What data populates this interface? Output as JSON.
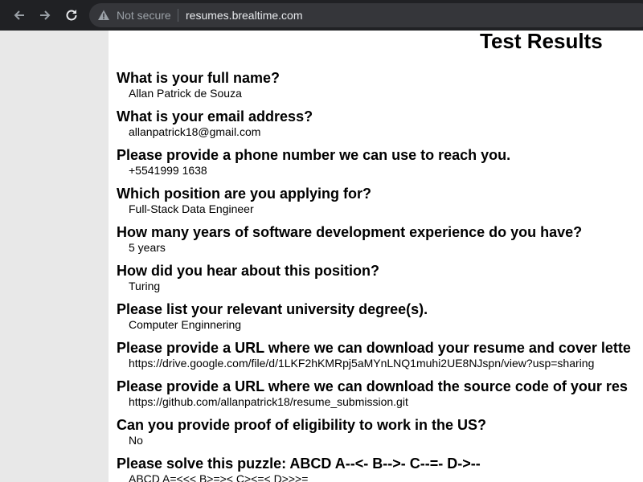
{
  "browser": {
    "security_label": "Not secure",
    "url": "resumes.brealtime.com",
    "icons": [
      "back-arrow-icon",
      "forward-arrow-icon",
      "reload-icon",
      "warning-triangle-icon"
    ]
  },
  "page": {
    "title": "Test Results",
    "items": [
      {
        "question": "What is your full name?",
        "answer": "Allan Patrick de Souza"
      },
      {
        "question": "What is your email address?",
        "answer": "allanpatrick18@gmail.com"
      },
      {
        "question": "Please provide a phone number we can use to reach you.",
        "answer": "+5541999 1638"
      },
      {
        "question": "Which position are you applying for?",
        "answer": "Full-Stack Data Engineer"
      },
      {
        "question": "How many years of software development experience do you have?",
        "answer": "5 years"
      },
      {
        "question": "How did you hear about this position?",
        "answer": "Turing"
      },
      {
        "question": "Please list your relevant university degree(s).",
        "answer": "Computer Enginnering"
      },
      {
        "question": "Please provide a URL where we can download your resume and cover lette",
        "answer": "https://drive.google.com/file/d/1LKF2hKMRpj5aMYnLNQ1muhi2UE8NJspn/view?usp=sharing"
      },
      {
        "question": "Please provide a URL where we can download the source code of your res",
        "answer": "https://github.com/allanpatrick18/resume_submission.git"
      },
      {
        "question": "Can you provide proof of eligibility to work in the US?",
        "answer": "No"
      },
      {
        "question": "Please solve this puzzle: ABCD A--<- B-->- C--=- D->--",
        "answer": "ABCD A=<<< B>=>< C><=< D>>>="
      }
    ]
  },
  "colors": {
    "toolbar_bg": "#202124",
    "omnibox_bg": "#35363a",
    "gutter_bg": "#e8e8e8"
  }
}
